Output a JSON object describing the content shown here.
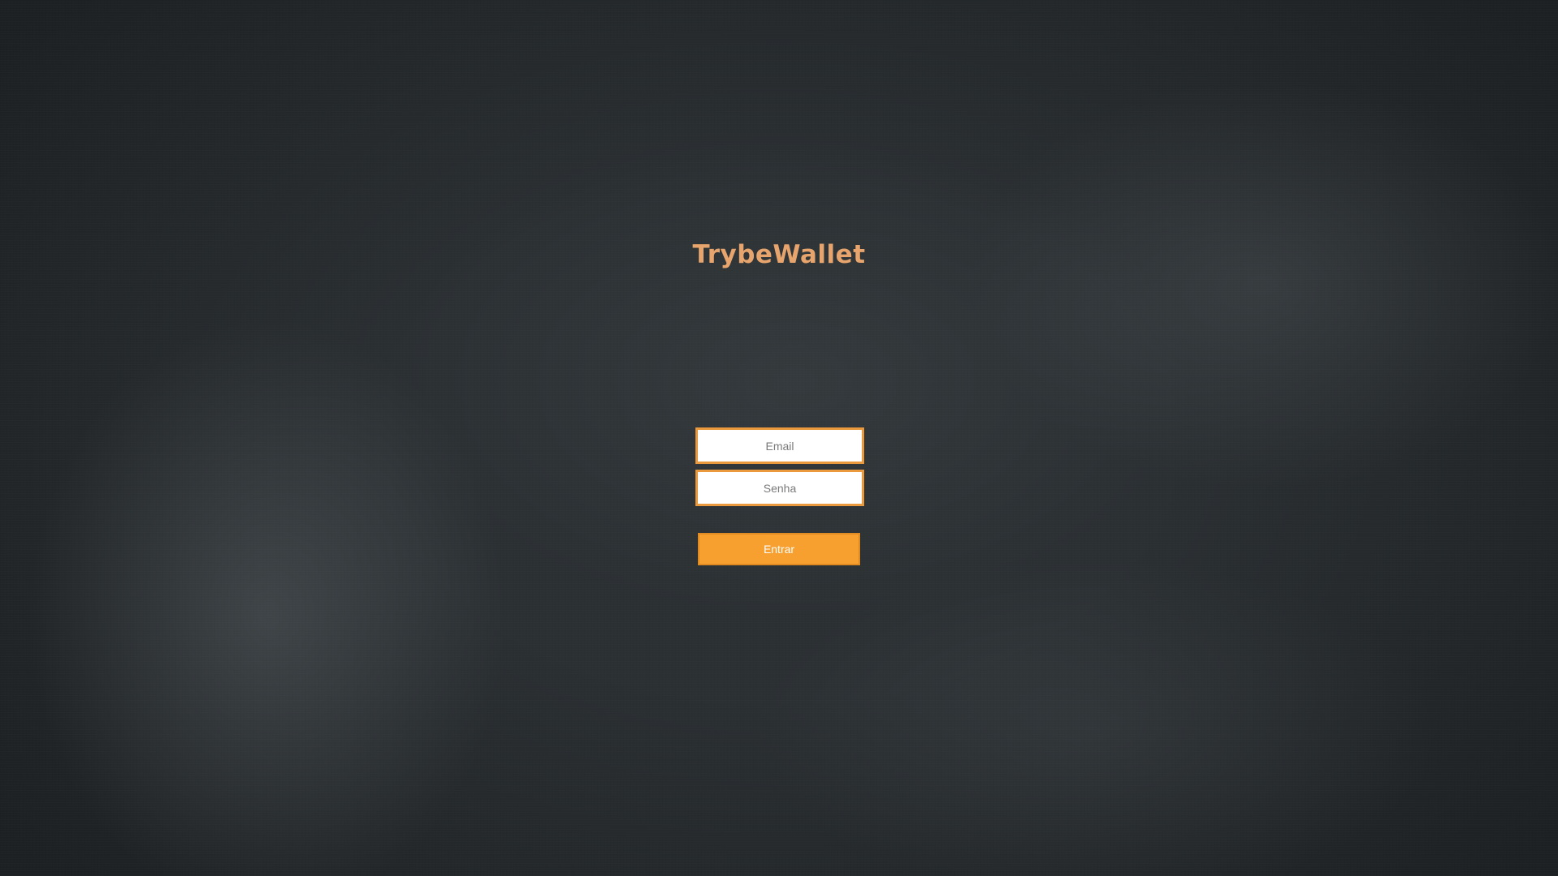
{
  "app": {
    "title": "TrybeWallet"
  },
  "login_form": {
    "email": {
      "value": "",
      "placeholder": "Email"
    },
    "password": {
      "value": "",
      "placeholder": "Senha"
    },
    "submit_label": "Entrar"
  },
  "colors": {
    "accent": "#f79f2f",
    "title": "#e7a56d",
    "background": "#2b3033"
  }
}
